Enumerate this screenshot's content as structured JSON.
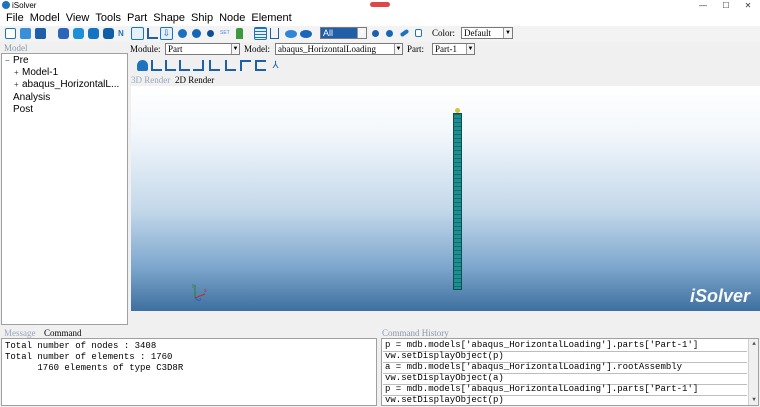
{
  "window": {
    "title": "iSolver",
    "minimize": "—",
    "maximize": "☐",
    "close": "✕"
  },
  "menu": [
    "File",
    "Model",
    "View",
    "Tools",
    "Part",
    "Shape",
    "Ship",
    "Node",
    "Element"
  ],
  "toolbar": {
    "set_label": "SET",
    "filter_value": "All",
    "color_label": "Color:",
    "color_value": "Default",
    "icons": [
      "new-icon",
      "open-icon",
      "save-icon",
      "cube-blue-icon",
      "cube-front-icon",
      "cube-side-icon",
      "cube-top-icon",
      "normal-icon",
      "select-box-icon",
      "measure-icon",
      "move-down-icon",
      "sphere-half-icon",
      "sphere-icon",
      "dot-icon",
      "set-icon",
      "tree-node-icon",
      "mesh-grid-icon",
      "mesh-column-icon",
      "surface-icon",
      "shape-icon",
      "point-icon",
      "cylinder-icon",
      "pencil-icon",
      "note-icon"
    ],
    "accent": "#1e73be"
  },
  "panel": {
    "model_title": "Model",
    "tree": [
      {
        "label": "Pre",
        "toggle": "−",
        "level": 0
      },
      {
        "label": "Model-1",
        "toggle": "+",
        "level": 1
      },
      {
        "label": "abaqus_HorizontalL...",
        "toggle": "+",
        "level": 1
      },
      {
        "label": "Analysis",
        "toggle": "",
        "level": 0
      },
      {
        "label": "Post",
        "toggle": "",
        "level": 0
      }
    ]
  },
  "selectors": {
    "module_label": "Module:",
    "module_value": "Part",
    "model_label": "Model:",
    "model_value": "abaqus_HorizontalLoading",
    "part_label": "Part:",
    "part_value": "Part-1"
  },
  "axes_icons": [
    "hand-icon",
    "axis-xy-icon",
    "axis-xz-icon",
    "axis-yz-icon",
    "axis-yx-icon",
    "axis-zx-icon",
    "axis-zy-icon",
    "axis-f-icon",
    "axis-t-icon",
    "axis-iso-icon"
  ],
  "render_tabs": {
    "tab3d": "3D Render",
    "tab2d": "2D Render"
  },
  "viewport": {
    "brand": "iSolver",
    "triad_x": "x",
    "triad_y": "y",
    "triad_z": "z"
  },
  "bottom_tabs": {
    "message": "Message",
    "command": "Command"
  },
  "messages": [
    "Total number of nodes : 3408",
    "Total number of elements : 1760",
    "      1760 elements of type C3D8R"
  ],
  "history_title": "Command History",
  "history": [
    "p = mdb.models['abaqus_HorizontalLoading'].parts['Part-1']",
    "vw.setDisplayObject(p)",
    "a = mdb.models['abaqus_HorizontalLoading'].rootAssembly",
    "vw.setDisplayObject(a)",
    "p = mdb.models['abaqus_HorizontalLoading'].parts['Part-1']",
    "vw.setDisplayObject(p)"
  ]
}
